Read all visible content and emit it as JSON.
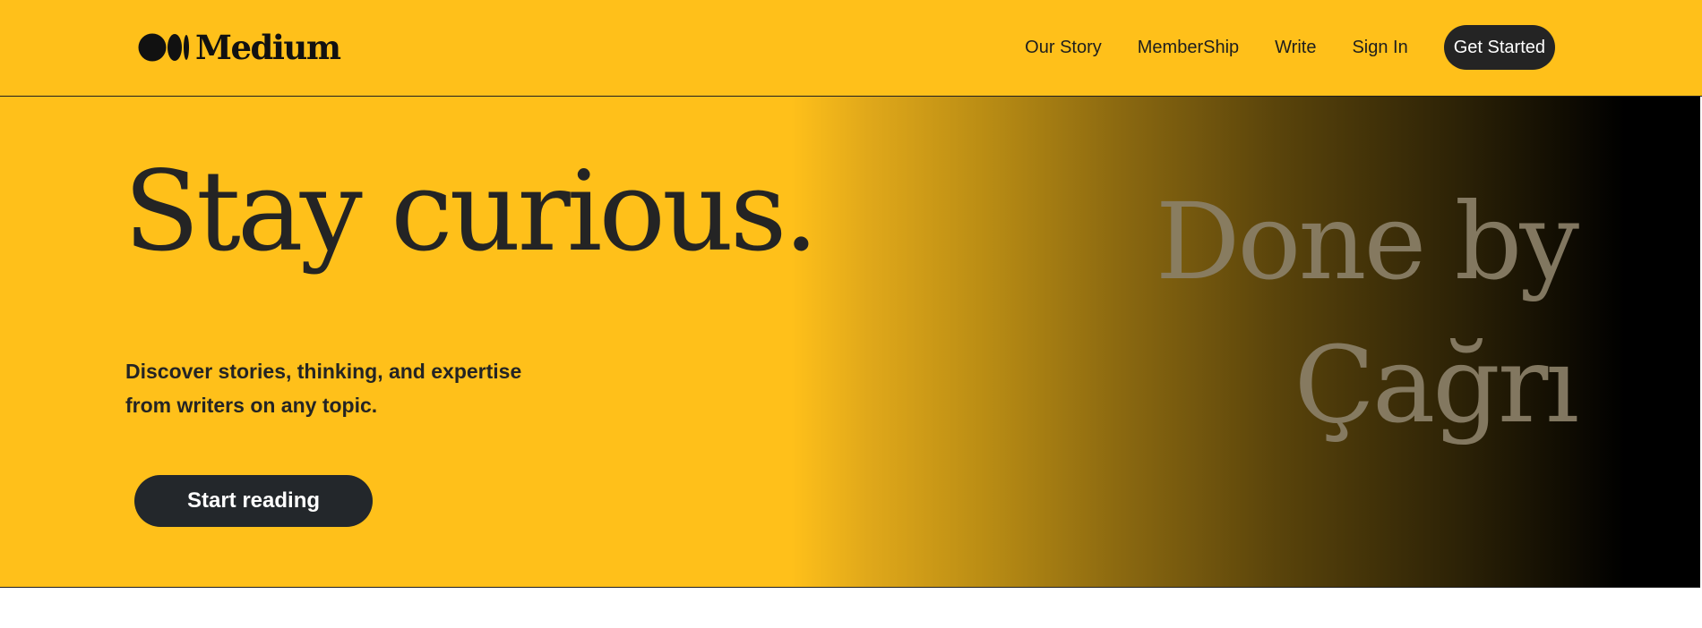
{
  "header": {
    "logo_text": "Medium",
    "nav": [
      {
        "label": "Our Story"
      },
      {
        "label": "MemberShip"
      },
      {
        "label": "Write"
      },
      {
        "label": "Sign In"
      }
    ],
    "cta_label": "Get Started"
  },
  "hero": {
    "headline": "Stay curious.",
    "subhead": "Discover stories, thinking, and expertise from writers on any topic.",
    "button_label": "Start reading",
    "overlay_line1": "Done by",
    "overlay_line2": "Çağrı"
  },
  "colors": {
    "brand_yellow": "#FFC01A",
    "button_dark": "#242424",
    "text_dark": "#242424",
    "overlay_text": "#8b8068"
  },
  "icons": {
    "logo": "medium-logo-icon"
  }
}
